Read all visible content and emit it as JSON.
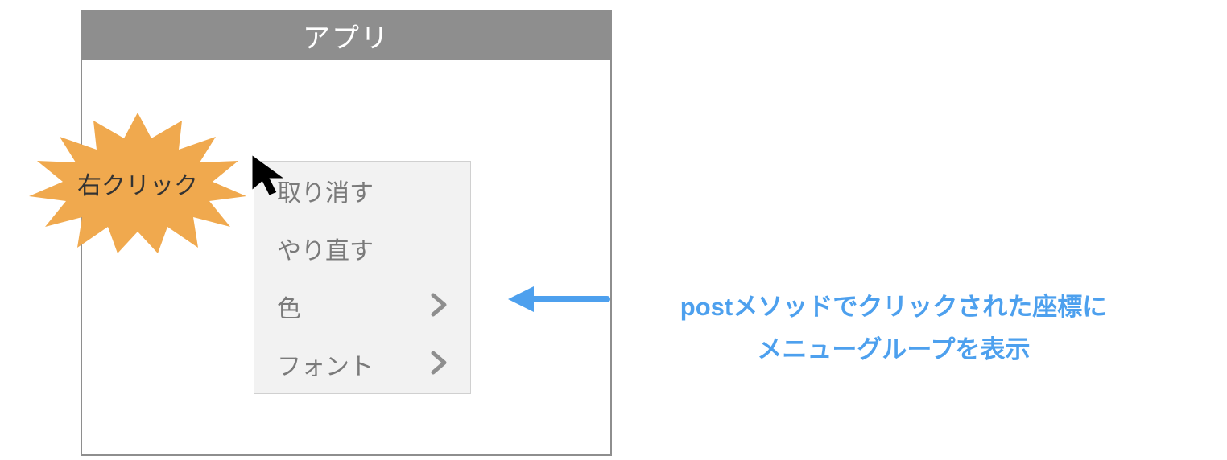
{
  "app": {
    "title": "アプリ"
  },
  "badge": {
    "label": "右クリック"
  },
  "context_menu": {
    "items": [
      {
        "label": "取り消す",
        "submenu": false
      },
      {
        "label": "やり直す",
        "submenu": false
      },
      {
        "label": "色",
        "submenu": true
      },
      {
        "label": "フォント",
        "submenu": true
      }
    ]
  },
  "annotation": {
    "line1": "postメソッドでクリックされた座標に",
    "line2": "メニューグループを表示"
  },
  "colors": {
    "accent": "#4da0ee",
    "badge_fill": "#f0a94e",
    "window_chrome": "#8e8e8e"
  }
}
